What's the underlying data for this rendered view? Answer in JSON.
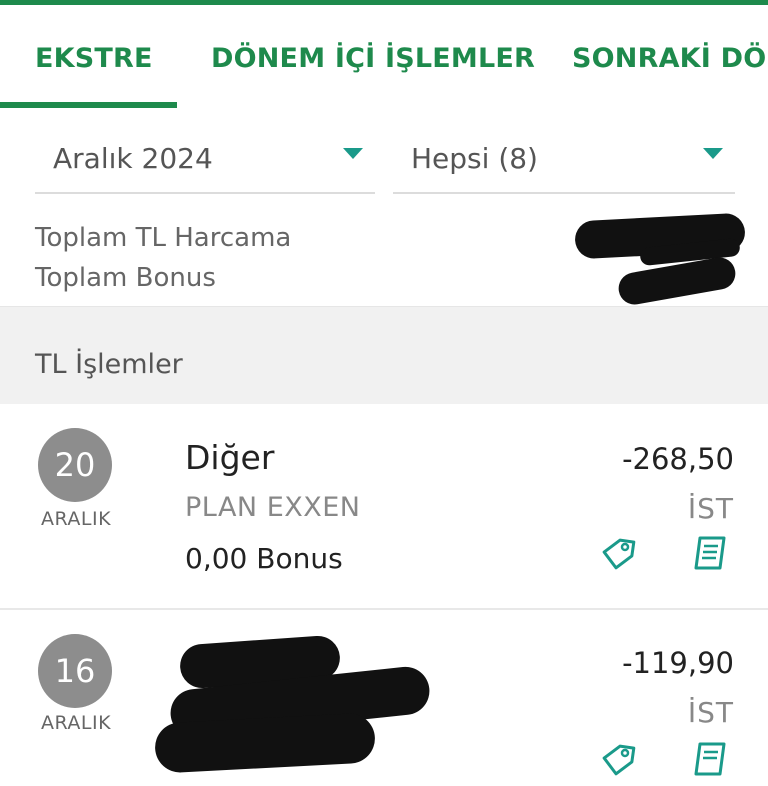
{
  "tabs": [
    {
      "label": "EKSTRE"
    },
    {
      "label": "DÖNEM İÇİ İŞLEMLER"
    },
    {
      "label": "SONRAKİ DÖN"
    }
  ],
  "filters": {
    "month": "Aralık 2024",
    "type": "Hepsi (8)"
  },
  "summary": {
    "total_tl_label": "Toplam TL Harcama",
    "total_bonus_label": "Toplam Bonus"
  },
  "section": {
    "title": "TL İşlemler"
  },
  "transactions": [
    {
      "day": "20",
      "month": "ARALIK",
      "category": "Diğer",
      "merchant": "PLAN EXXEN",
      "bonus": "0,00 Bonus",
      "amount": "-268,50",
      "city": "İST"
    },
    {
      "day": "16",
      "month": "ARALIK",
      "amount": "-119,90",
      "city": "İST"
    }
  ],
  "colors": {
    "brand_green": "#1e8a4c",
    "icon_teal": "#1a9a8a",
    "day_circle": "#8d8d8d"
  },
  "icons": [
    "caret-down-icon",
    "tag-icon",
    "receipt-icon"
  ]
}
